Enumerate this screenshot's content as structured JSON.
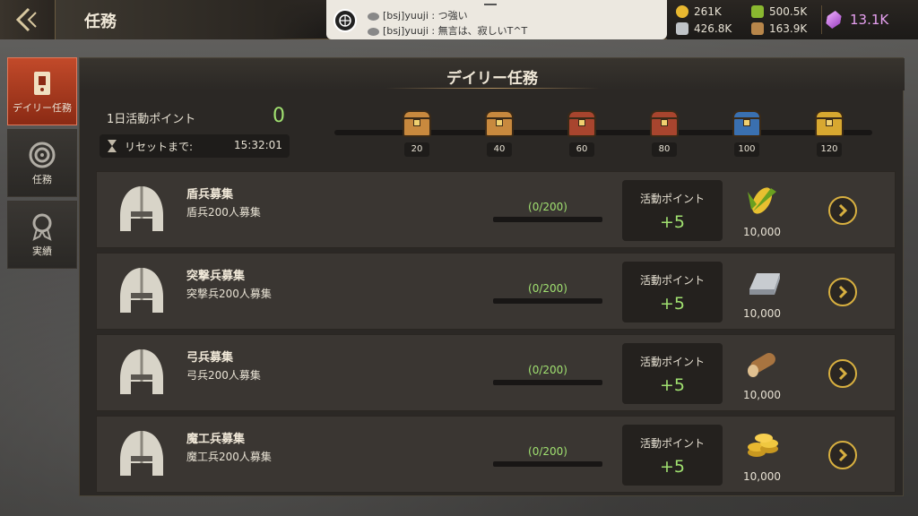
{
  "header": {
    "title": "任務"
  },
  "chat": {
    "line1": "[bsj]yuuji : つ強い",
    "line2": "[bsj]yuuji : 無言は、寂しいT^T"
  },
  "resources": {
    "gold": "261K",
    "food": "500.5K",
    "iron": "426.8K",
    "wood": "163.9K",
    "gems": "13.1K"
  },
  "sidebar": {
    "items": [
      {
        "label": "デイリー任務",
        "icon": "scroll-icon",
        "active": true
      },
      {
        "label": "任務",
        "icon": "target-icon",
        "active": false
      },
      {
        "label": "実績",
        "icon": "medal-icon",
        "active": false
      }
    ]
  },
  "panel": {
    "title": "デイリー任務",
    "day_label": "1日活動ポイント",
    "day_points": "0",
    "reset_label": "リセットまで:",
    "reset_time": "15:32:01"
  },
  "chests": [
    {
      "points": "20",
      "color": "#c8893e"
    },
    {
      "points": "40",
      "color": "#c8893e"
    },
    {
      "points": "60",
      "color": "#a8452e"
    },
    {
      "points": "80",
      "color": "#a8452e"
    },
    {
      "points": "100",
      "color": "#3a70b0"
    },
    {
      "points": "120",
      "color": "#d8a830"
    }
  ],
  "tasks": [
    {
      "name": "盾兵募集",
      "desc": "盾兵200人募集",
      "progress": "(0/200)",
      "progress_fraction": 0,
      "act_label": "活動ポイント",
      "act_value": "+5",
      "reward_icon": "corn-icon",
      "reward_amount": "10,000"
    },
    {
      "name": "突撃兵募集",
      "desc": "突撃兵200人募集",
      "progress": "(0/200)",
      "progress_fraction": 0,
      "act_label": "活動ポイント",
      "act_value": "+5",
      "reward_icon": "iron-ingot-icon",
      "reward_amount": "10,000"
    },
    {
      "name": "弓兵募集",
      "desc": "弓兵200人募集",
      "progress": "(0/200)",
      "progress_fraction": 0,
      "act_label": "活動ポイント",
      "act_value": "+5",
      "reward_icon": "wood-log-icon",
      "reward_amount": "10,000"
    },
    {
      "name": "魔工兵募集",
      "desc": "魔工兵200人募集",
      "progress": "(0/200)",
      "progress_fraction": 0,
      "act_label": "活動ポイント",
      "act_value": "+5",
      "reward_icon": "gold-coins-icon",
      "reward_amount": "10,000"
    }
  ],
  "colors": {
    "accent_green": "#a0e070",
    "active_tab": "#c24a2a",
    "gem": "#e6a0f0"
  }
}
